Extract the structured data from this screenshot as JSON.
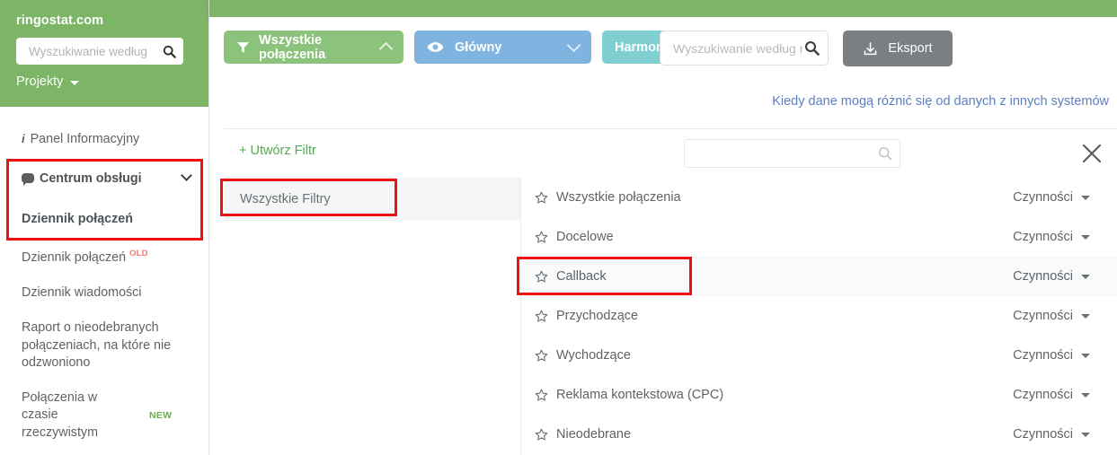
{
  "sidebar": {
    "brand": "ringostat.com",
    "search_placeholder": "Wyszukiwanie według",
    "search_value": "",
    "search_icon": "search-icon",
    "projects_label": "Projekty",
    "items": [
      {
        "label": "Panel Informacyjny",
        "icon": "info-icon",
        "badge": "",
        "bold": false
      },
      {
        "label": "Centrum obsługi",
        "icon": "chat-bubble-icon",
        "badge": "",
        "bold": true
      },
      {
        "label": "Dziennik połączeń",
        "icon": "",
        "badge": "",
        "bold": true
      },
      {
        "label": "Dziennik połączeń",
        "icon": "",
        "badge": "OLD",
        "bold": false
      },
      {
        "label": "Dziennik wiadomości",
        "icon": "",
        "badge": "",
        "bold": false
      },
      {
        "label": "Raport o nieodebranych połączeniach, na które nie odzwoniono",
        "icon": "",
        "badge": "",
        "bold": false
      },
      {
        "label": "Połączenia w czasie rzeczywistym",
        "icon": "",
        "badge": "NEW",
        "bold": false
      }
    ]
  },
  "toolbar": {
    "filter_button": {
      "label": "Wszystkie połączenia",
      "icon": "funnel-icon",
      "chevron": "chevron-up-icon",
      "color": "#8cc37c"
    },
    "view_button": {
      "label": "Główny",
      "icon": "eye-icon",
      "chevron": "chevron-down-icon",
      "color": "#7fb3e0"
    },
    "schedule_button": {
      "label": "Harmon",
      "color": "#7fcfd0"
    },
    "search": {
      "placeholder": "Wyszukiwanie według r",
      "value": "",
      "icon": "search-icon"
    },
    "export_button": {
      "label": "Eksport",
      "icon": "download-icon",
      "color": "#7b7f82"
    },
    "hint_link": "Kiedy dane mogą różnić się od danych z innych systemów"
  },
  "filter_panel": {
    "create_filter_label": "+ Utwórz Filtr",
    "search": {
      "placeholder": "",
      "value": "",
      "icon": "search-icon"
    },
    "close_icon": "close-icon",
    "tabs": [
      {
        "label": "Wszystkie Filtry",
        "selected": true
      }
    ],
    "action_label": "Czynności",
    "rows": [
      {
        "name": "Wszystkie połączenia",
        "star": "star-outline-icon",
        "action": "Czynności",
        "highlighted": false
      },
      {
        "name": "Docelowe",
        "star": "star-outline-icon",
        "action": "Czynności",
        "highlighted": false
      },
      {
        "name": "Callback",
        "star": "star-outline-icon",
        "action": "Czynności",
        "highlighted": true
      },
      {
        "name": "Przychodzące",
        "star": "star-outline-icon",
        "action": "Czynności",
        "highlighted": false
      },
      {
        "name": "Wychodzące",
        "star": "star-outline-icon",
        "action": "Czynności",
        "highlighted": false
      },
      {
        "name": "Reklama kontekstowa (CPC)",
        "star": "star-outline-icon",
        "action": "Czynności",
        "highlighted": false
      },
      {
        "name": "Nieodebrane",
        "star": "star-outline-icon",
        "action": "Czynności",
        "highlighted": false
      }
    ]
  },
  "annotations": [
    {
      "name": "sidebar-highlight"
    },
    {
      "name": "all-filters-tab-highlight"
    },
    {
      "name": "callback-row-highlight"
    }
  ],
  "colors": {
    "brand_green": "#7cb566",
    "link_blue": "#5a7fc4",
    "accent_green": "#54a953",
    "annotation_red": "#ee1111"
  }
}
